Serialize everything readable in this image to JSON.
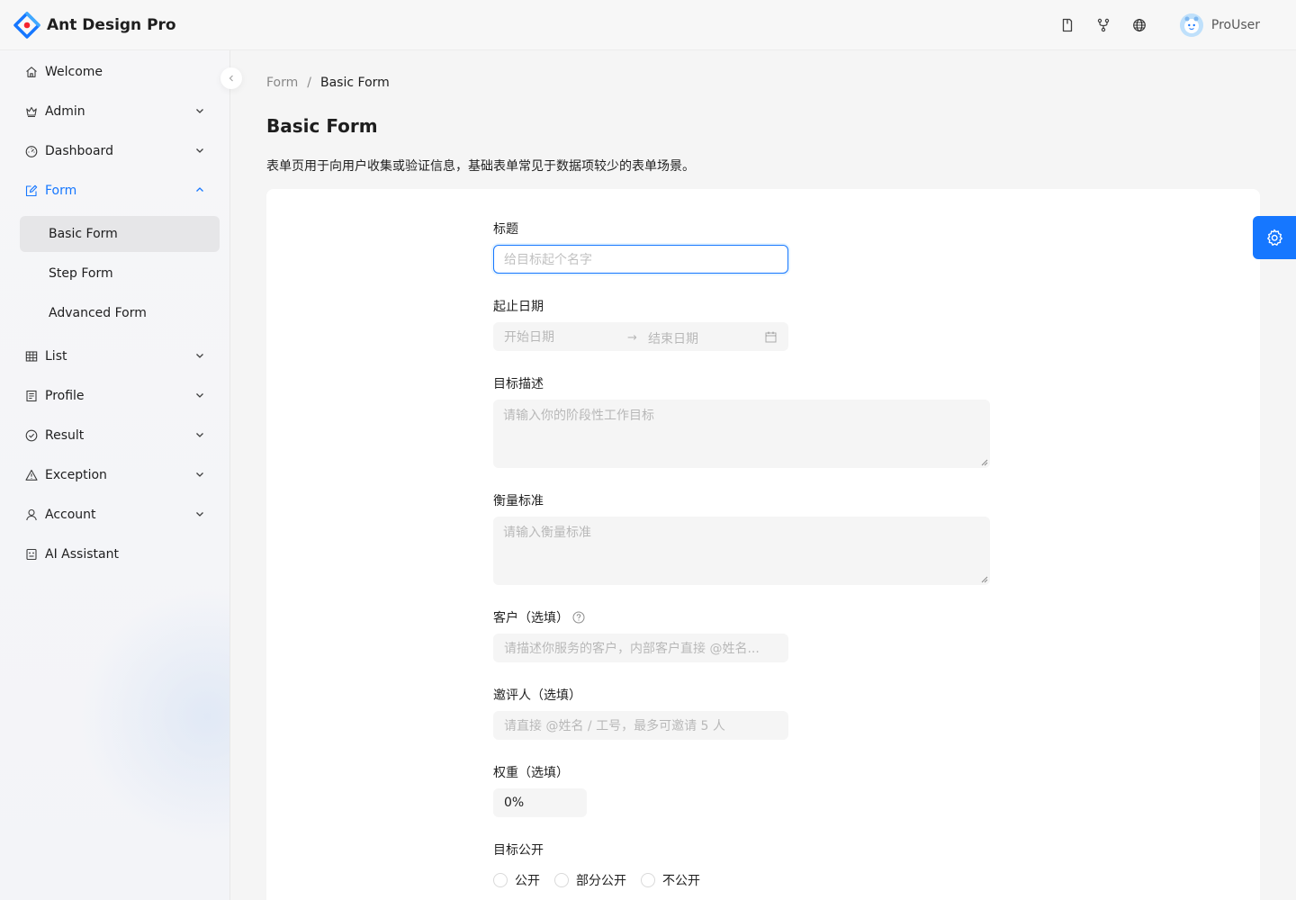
{
  "app": {
    "title": "Ant Design Pro",
    "user": "ProUser"
  },
  "header_icons": [
    "doc-icon",
    "fork-icon",
    "globe-icon"
  ],
  "sidebar": {
    "items": [
      {
        "label": "Welcome",
        "icon": "home-icon"
      },
      {
        "label": "Admin",
        "icon": "crown-icon"
      },
      {
        "label": "Dashboard",
        "icon": "dashboard-icon"
      },
      {
        "label": "Form",
        "icon": "form-icon",
        "expanded": true
      },
      {
        "label": "List",
        "icon": "table-icon"
      },
      {
        "label": "Profile",
        "icon": "profile-icon"
      },
      {
        "label": "Result",
        "icon": "check-circle-icon"
      },
      {
        "label": "Exception",
        "icon": "warning-icon"
      },
      {
        "label": "Account",
        "icon": "user-icon"
      },
      {
        "label": "AI Assistant",
        "icon": "robot-icon"
      }
    ],
    "sub_items": [
      {
        "label": "Basic Form",
        "selected": true
      },
      {
        "label": "Step Form"
      },
      {
        "label": "Advanced Form"
      }
    ]
  },
  "breadcrumb": {
    "parent": "Form",
    "separator": "/",
    "current": "Basic Form"
  },
  "page": {
    "title": "Basic Form",
    "description": "表单页用于向用户收集或验证信息，基础表单常见于数据项较少的表单场景。"
  },
  "form": {
    "title_label": "标题",
    "title_placeholder": "给目标起个名字",
    "date_label": "起止日期",
    "date_start_placeholder": "开始日期",
    "date_end_placeholder": "结束日期",
    "goal_label": "目标描述",
    "goal_placeholder": "请输入你的阶段性工作目标",
    "standard_label": "衡量标准",
    "standard_placeholder": "请输入衡量标准",
    "client_label": "客户（选填）",
    "client_placeholder": "请描述你服务的客户，内部客户直接 @姓名...",
    "invites_label": "邀评人（选填）",
    "invites_placeholder": "请直接 @姓名 / 工号，最多可邀请 5 人",
    "weight_label": "权重（选填）",
    "weight_value": "0%",
    "public_label": "目标公开",
    "public_options": [
      "公开",
      "部分公开",
      "不公开"
    ]
  },
  "colors": {
    "primary": "#1677ff"
  }
}
